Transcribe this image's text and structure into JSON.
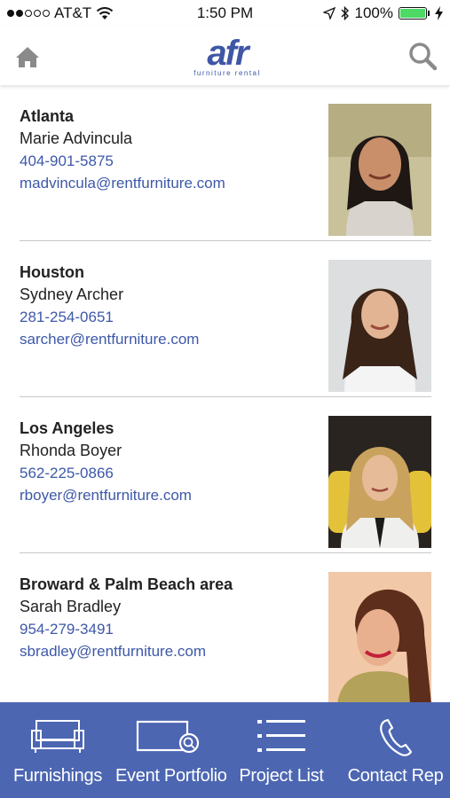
{
  "status_bar": {
    "carrier": "AT&T",
    "time": "1:50 PM",
    "battery_percent": "100%",
    "signal_strength": 2,
    "signal_max": 5
  },
  "header": {
    "logo_mark": "afr",
    "logo_subtitle": "furniture rental",
    "home_icon": "home-icon",
    "search_icon": "search-icon",
    "brand_color": "#3f56a6"
  },
  "contacts": [
    {
      "city": "Atlanta",
      "name": "Marie Advincula",
      "phone": "404-901-5875",
      "email": "madvincula@rentfurniture.com"
    },
    {
      "city": "Houston",
      "name": "Sydney Archer",
      "phone": "281-254-0651",
      "email": "sarcher@rentfurniture.com"
    },
    {
      "city": "Los Angeles",
      "name": "Rhonda Boyer",
      "phone": "562-225-0866",
      "email": "rboyer@rentfurniture.com"
    },
    {
      "city": "Broward & Palm Beach area",
      "name": "Sarah Bradley",
      "phone": "954-279-3491",
      "email": "sbradley@rentfurniture.com"
    }
  ],
  "bottom_nav": {
    "background": "#4c66b2",
    "items": [
      {
        "label": "Furnishings",
        "icon": "sofa-icon"
      },
      {
        "label": "Event Portfolio",
        "icon": "event-portfolio-icon"
      },
      {
        "label": "Project List",
        "icon": "list-icon"
      },
      {
        "label": "Contact Rep",
        "icon": "phone-icon"
      }
    ]
  }
}
